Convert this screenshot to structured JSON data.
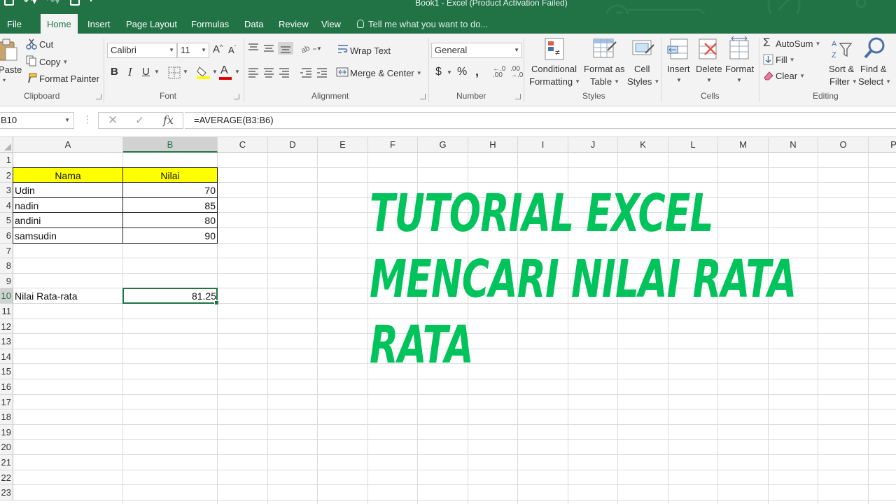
{
  "window": {
    "title": "Book1 - Excel (Product Activation Failed)",
    "brand_color": "#217346"
  },
  "tabs": [
    {
      "label": "File",
      "active": false
    },
    {
      "label": "Home",
      "active": true
    },
    {
      "label": "Insert",
      "active": false
    },
    {
      "label": "Page Layout",
      "active": false
    },
    {
      "label": "Formulas",
      "active": false
    },
    {
      "label": "Data",
      "active": false
    },
    {
      "label": "Review",
      "active": false
    },
    {
      "label": "View",
      "active": false
    }
  ],
  "tell_me": "Tell me what you want to do...",
  "ribbon": {
    "clipboard": {
      "paste": "Paste",
      "cut": "Cut",
      "copy": "Copy",
      "format_painter": "Format Painter",
      "label": "Clipboard"
    },
    "font": {
      "name": "Calibri",
      "size": "11",
      "bold": "B",
      "italic": "I",
      "underline": "U",
      "label": "Font"
    },
    "alignment": {
      "wrap_text": "Wrap Text",
      "merge_center": "Merge & Center",
      "label": "Alignment"
    },
    "number": {
      "format": "General",
      "currency": "$",
      "percent": "%",
      "comma": "̓",
      "label": "Number"
    },
    "styles": {
      "conditional_1": "Conditional",
      "conditional_2": "Formatting",
      "format_as_1": "Format as",
      "format_as_2": "Table",
      "cell_styles_1": "Cell",
      "cell_styles_2": "Styles",
      "label": "Styles"
    },
    "cells": {
      "insert": "Insert",
      "delete": "Delete",
      "format": "Format",
      "label": "Cells"
    },
    "editing": {
      "autosum": "AutoSum",
      "fill": "Fill",
      "clear": "Clear",
      "sort_1": "Sort &",
      "sort_2": "Filter",
      "find_1": "Find &",
      "find_2": "Select",
      "label": "Editing"
    }
  },
  "formula_bar": {
    "name_box": "B10",
    "formula": "=AVERAGE(B3:B6)",
    "fx": "fx"
  },
  "sheet": {
    "columns": [
      "A",
      "B",
      "C",
      "D",
      "E",
      "F",
      "G",
      "H",
      "I",
      "J",
      "K",
      "L",
      "M",
      "N",
      "O",
      "P"
    ],
    "selected_column": "B",
    "rows": [
      "1",
      "2",
      "3",
      "4",
      "5",
      "6",
      "7",
      "8",
      "9",
      "10",
      "11",
      "12",
      "13",
      "14",
      "15",
      "16",
      "17",
      "18",
      "19",
      "20",
      "21",
      "22",
      "23"
    ],
    "selected_row": "10",
    "header_row": {
      "a": "Nama",
      "b": "Nilai",
      "fill_color": "#ffff00"
    },
    "data_rows": [
      {
        "name": "Udin",
        "value": "70"
      },
      {
        "name": "nadin",
        "value": "85"
      },
      {
        "name": "andini",
        "value": "80"
      },
      {
        "name": "samsudin",
        "value": "90"
      }
    ],
    "summary": {
      "label": "Nilai Rata-rata",
      "value": "81.25"
    }
  },
  "overlay": {
    "lines": [
      "TUTORIAL EXCEL",
      "MENCARI NILAI RATA",
      "RATA"
    ],
    "color": "#00c35b"
  }
}
